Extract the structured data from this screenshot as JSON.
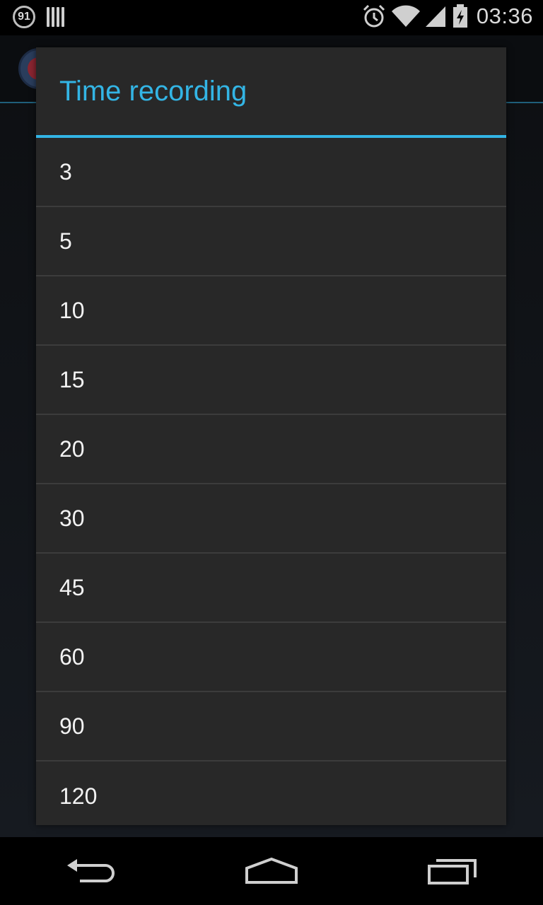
{
  "status_bar": {
    "notification_badge": "91",
    "time": "03:36",
    "icons": [
      "notification-count-icon",
      "barcode-icon",
      "alarm-icon",
      "wifi-icon",
      "signal-icon",
      "battery-charging-icon"
    ]
  },
  "dialog": {
    "title": "Time recording",
    "options": [
      "3",
      "5",
      "10",
      "15",
      "20",
      "30",
      "45",
      "60",
      "90",
      "120"
    ]
  },
  "nav_bar": {
    "icons": [
      "back-icon",
      "home-icon",
      "recents-icon"
    ]
  },
  "colors": {
    "accent": "#33b5e5",
    "dialog_background": "#282828",
    "divider": "#3c3c3c"
  }
}
